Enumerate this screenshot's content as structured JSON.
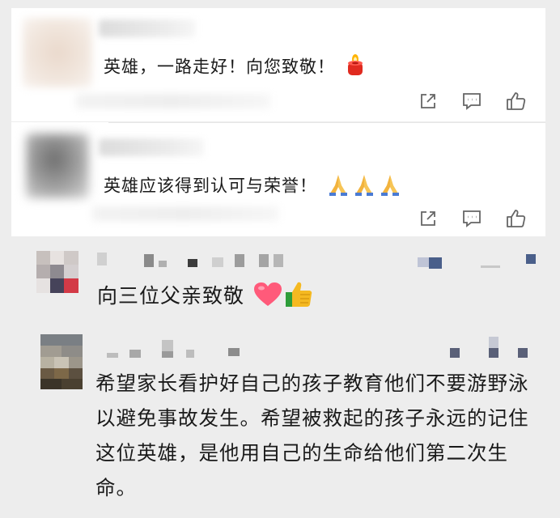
{
  "comments": [
    {
      "text": "英雄，一路走好！向您致敬！",
      "emojis": [
        "candle-emoji"
      ],
      "actions": [
        "share-icon",
        "comment-icon",
        "like-icon"
      ]
    },
    {
      "text": "英雄应该得到认可与荣誉！",
      "emojis": [
        "pray-emoji",
        "pray-emoji",
        "pray-emoji"
      ],
      "actions": [
        "share-icon",
        "comment-icon",
        "like-icon"
      ]
    }
  ],
  "posts": [
    {
      "text": "向三位父亲致敬",
      "emojis": [
        "heart-emoji",
        "thumbs-up-emoji"
      ]
    },
    {
      "text": "希望家长看护好自己的孩子教育他们不要游野泳以避免事故发生。希望被救起的孩子永远的记住这位英雄，是他用自己的生命给他们第二次生命。"
    }
  ],
  "colors": {
    "card_bg": "#ffffff",
    "page_bg": "#ededed",
    "text": "#1b1b1b",
    "icon": "#666666",
    "heart": "#ff5a7a",
    "thumb": "#f5b921"
  }
}
